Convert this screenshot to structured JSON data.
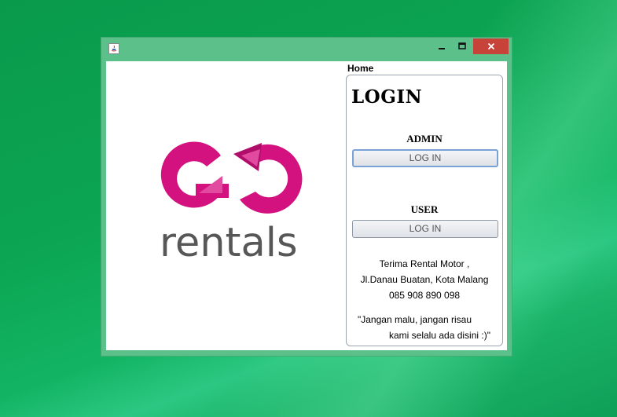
{
  "window": {
    "title": "",
    "controls": {
      "minimize": "minimize-icon",
      "maximize": "maximize-icon",
      "close": "close-icon"
    },
    "titlebar_color": "#5cc08a",
    "close_color": "#c7433a"
  },
  "logo": {
    "wordmark": "rentals",
    "brand_color": "#d3117f"
  },
  "tab": {
    "label": "Home"
  },
  "login": {
    "title": "LOGIN",
    "admin": {
      "label": "ADMIN",
      "button": "LOG IN"
    },
    "user": {
      "label": "USER",
      "button": "LOG IN"
    }
  },
  "info": {
    "line1": "Terima Rental Motor ,",
    "line2": "Jl.Danau Buatan, Kota Malang",
    "phone": "085 908 890 098"
  },
  "quote": {
    "line1": "\"Jangan malu, jangan risau",
    "line2": "kami selalu ada disini :)\""
  }
}
